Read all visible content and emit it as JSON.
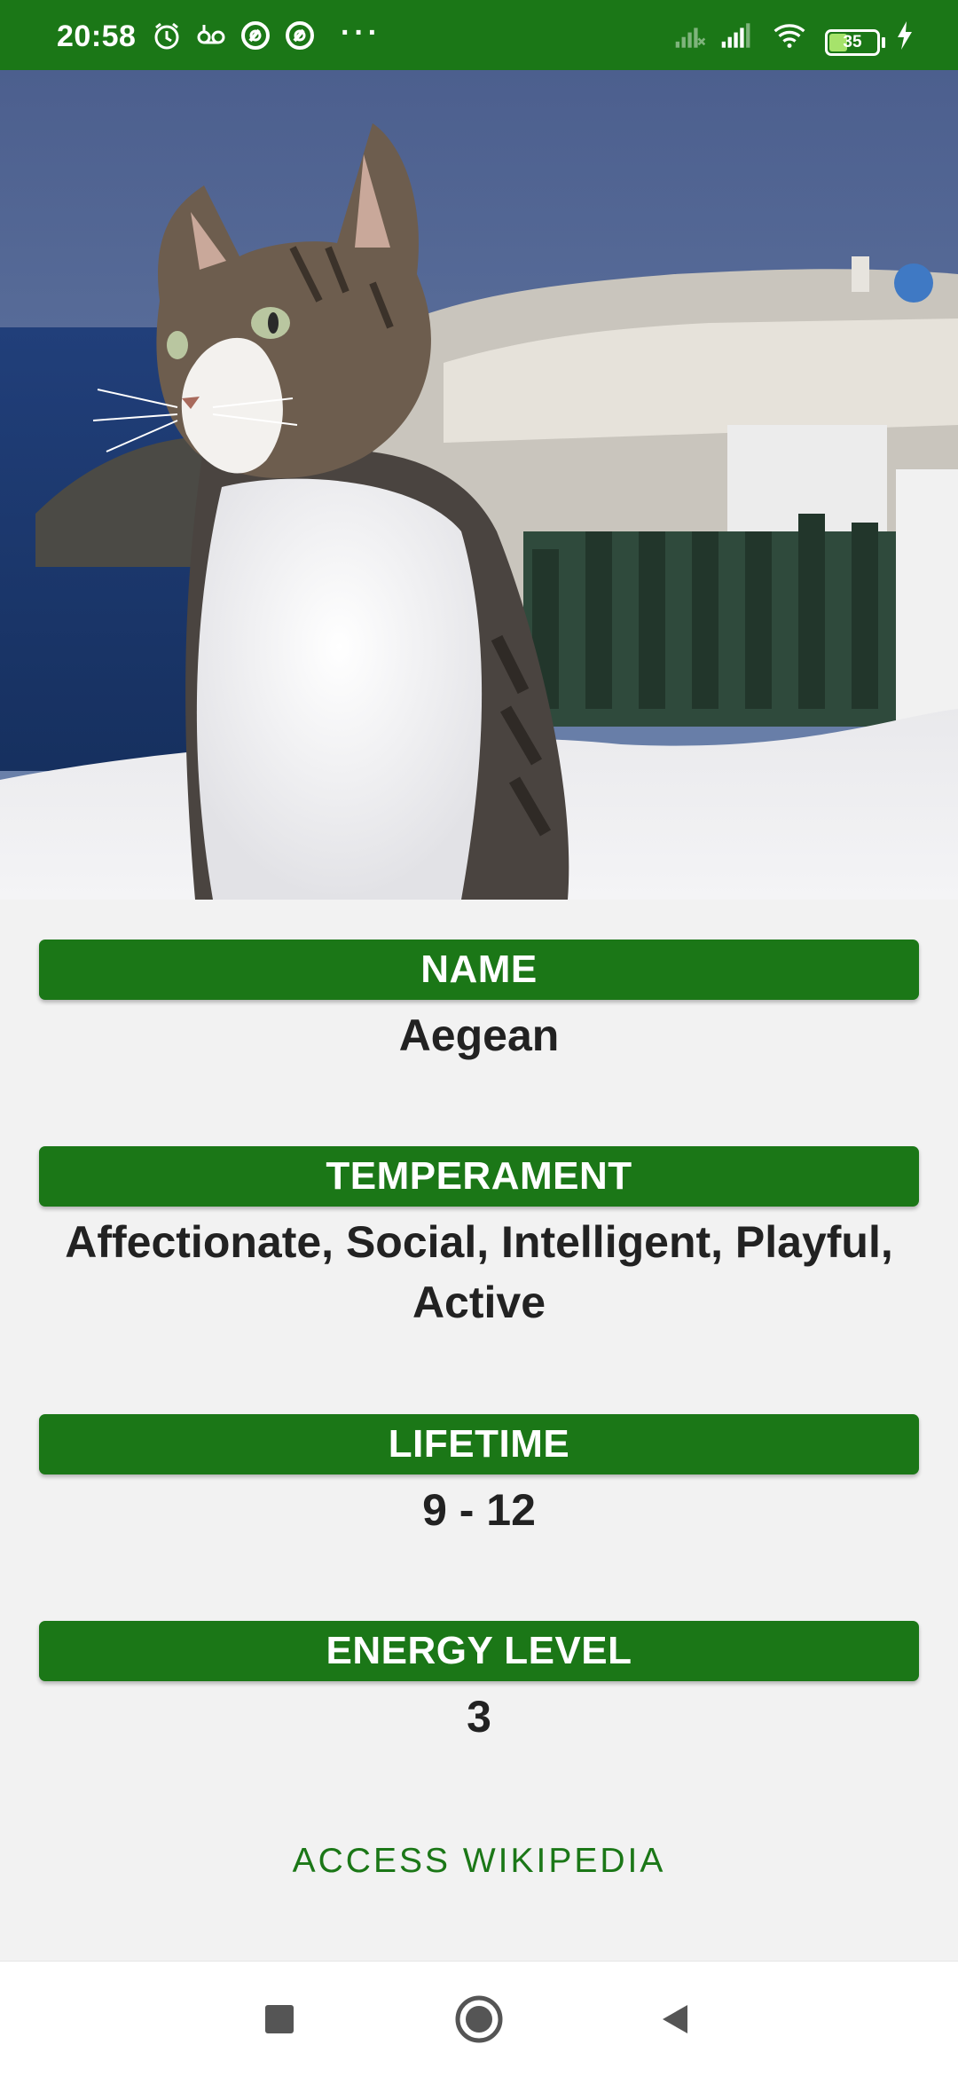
{
  "status_bar": {
    "time": "20:58",
    "icons": [
      "alarm-icon",
      "voicemail-icon",
      "at-sign-icon",
      "at-sign-icon",
      "more-dots-icon"
    ],
    "dots": "···",
    "right_icons": [
      "signal-off-icon",
      "signal-icon",
      "wifi-icon",
      "battery-icon",
      "charging-icon"
    ],
    "battery_level": "35"
  },
  "hero": {
    "image_label": "cat-photo"
  },
  "sections": [
    {
      "header": "NAME",
      "value": "Aegean"
    },
    {
      "header": "TEMPERAMENT",
      "value": "Affectionate, Social, Intelligent, Playful, Active"
    },
    {
      "header": "LIFETIME",
      "value": "9 - 12"
    },
    {
      "header": "ENERGY LEVEL",
      "value": "3"
    }
  ],
  "wiki_link": "ACCESS WIKIPEDIA",
  "nav_bar": {
    "buttons": [
      "recents-square-icon",
      "home-circle-icon",
      "back-triangle-icon"
    ]
  },
  "colors": {
    "primary": "#1b7717",
    "background": "#f2f2f2",
    "text": "#222222"
  }
}
